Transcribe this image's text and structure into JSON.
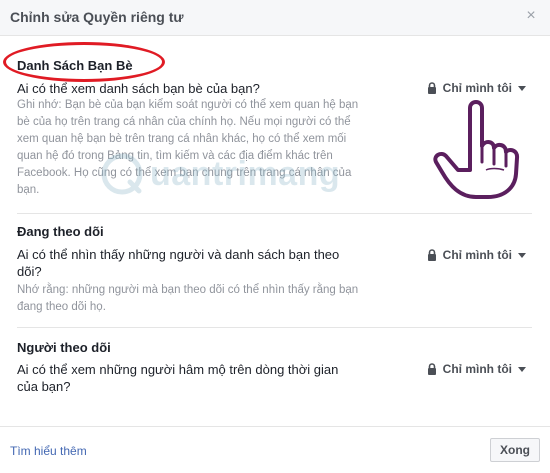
{
  "header": {
    "title": "Chỉnh sửa Quyền riêng tư",
    "close_symbol": "×"
  },
  "sections": [
    {
      "title": "Danh Sách Bạn Bè",
      "question": "Ai có thể xem danh sách bạn bè của bạn?",
      "note": "Ghi nhớ: Bạn bè của bạn kiểm soát người có thể xem quan hệ bạn bè của họ trên trang cá nhân của chính họ. Nếu mọi người có thể xem quan hệ bạn bè trên trang cá nhân khác, họ có thể xem mối quan hệ đó trong Bảng tin, tìm kiếm và các địa điểm khác trên Facebook. Họ cũng có thể xem bạn chung trên trang cá nhân của bạn.",
      "privacy": "Chỉ mình tôi"
    },
    {
      "title": "Đang theo dõi",
      "question": "Ai có thể nhìn thấy những người và danh sách bạn theo dõi?",
      "note": "Nhớ rằng: những người mà bạn theo dõi có thể nhìn thấy rằng bạn đang theo dõi họ.",
      "privacy": "Chỉ mình tôi"
    },
    {
      "title": "Người theo dõi",
      "question": "Ai có thể xem những người hâm mộ trên dòng thời gian của bạn?",
      "privacy": "Chỉ mình tôi"
    }
  ],
  "footer": {
    "learn_more": "Tìm hiểu thêm",
    "done": "Xong"
  },
  "watermark": {
    "text": "uantrimang"
  },
  "icons": {
    "lock": "lock-icon",
    "caret": "caret-down-icon",
    "close": "close-icon"
  },
  "colors": {
    "link": "#4267b2",
    "annotation": "#e01b24",
    "hand": "#5b1f5e"
  }
}
